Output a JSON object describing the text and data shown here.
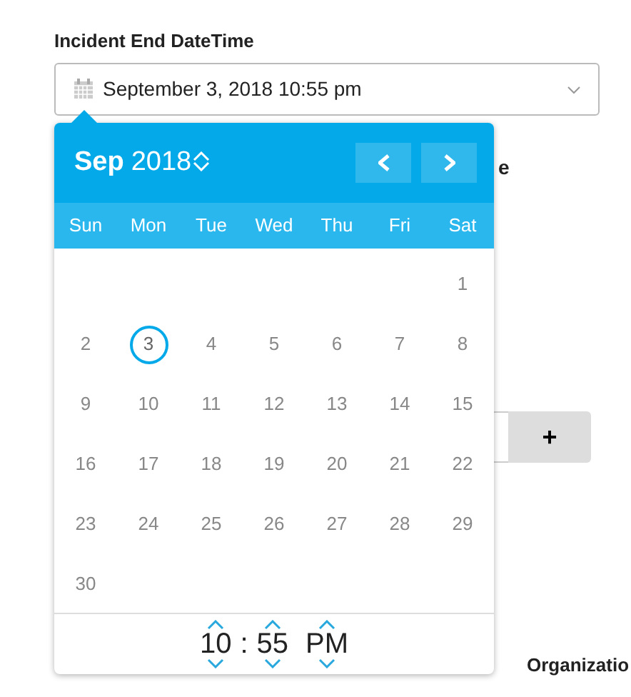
{
  "field": {
    "label": "Incident End DateTime",
    "value": "September 3, 2018 10:55 pm"
  },
  "behind": {
    "partial_label": "e",
    "add_button": "+",
    "section_label": "Organizatio"
  },
  "calendar": {
    "month": "Sep",
    "year": "2018",
    "weekdays": [
      "Sun",
      "Mon",
      "Tue",
      "Wed",
      "Thu",
      "Fri",
      "Sat"
    ],
    "weeks": [
      {
        "kind": "trailing",
        "days": [
          {
            "label": "1",
            "selected": false
          }
        ]
      },
      {
        "kind": "full",
        "days": [
          {
            "label": "2",
            "selected": false
          },
          {
            "label": "3",
            "selected": true
          },
          {
            "label": "4",
            "selected": false
          },
          {
            "label": "5",
            "selected": false
          },
          {
            "label": "6",
            "selected": false
          },
          {
            "label": "7",
            "selected": false
          },
          {
            "label": "8",
            "selected": false
          }
        ]
      },
      {
        "kind": "full",
        "days": [
          {
            "label": "9",
            "selected": false
          },
          {
            "label": "10",
            "selected": false
          },
          {
            "label": "11",
            "selected": false
          },
          {
            "label": "12",
            "selected": false
          },
          {
            "label": "13",
            "selected": false
          },
          {
            "label": "14",
            "selected": false
          },
          {
            "label": "15",
            "selected": false
          }
        ]
      },
      {
        "kind": "full",
        "days": [
          {
            "label": "16",
            "selected": false
          },
          {
            "label": "17",
            "selected": false
          },
          {
            "label": "18",
            "selected": false
          },
          {
            "label": "19",
            "selected": false
          },
          {
            "label": "20",
            "selected": false
          },
          {
            "label": "21",
            "selected": false
          },
          {
            "label": "22",
            "selected": false
          }
        ]
      },
      {
        "kind": "full",
        "days": [
          {
            "label": "23",
            "selected": false
          },
          {
            "label": "24",
            "selected": false
          },
          {
            "label": "25",
            "selected": false
          },
          {
            "label": "26",
            "selected": false
          },
          {
            "label": "27",
            "selected": false
          },
          {
            "label": "28",
            "selected": false
          },
          {
            "label": "29",
            "selected": false
          }
        ]
      },
      {
        "kind": "leading",
        "days": [
          {
            "label": "30",
            "selected": false
          }
        ]
      }
    ],
    "time": {
      "hour": "10",
      "separator": ":",
      "minute": "55",
      "period": "PM"
    }
  }
}
